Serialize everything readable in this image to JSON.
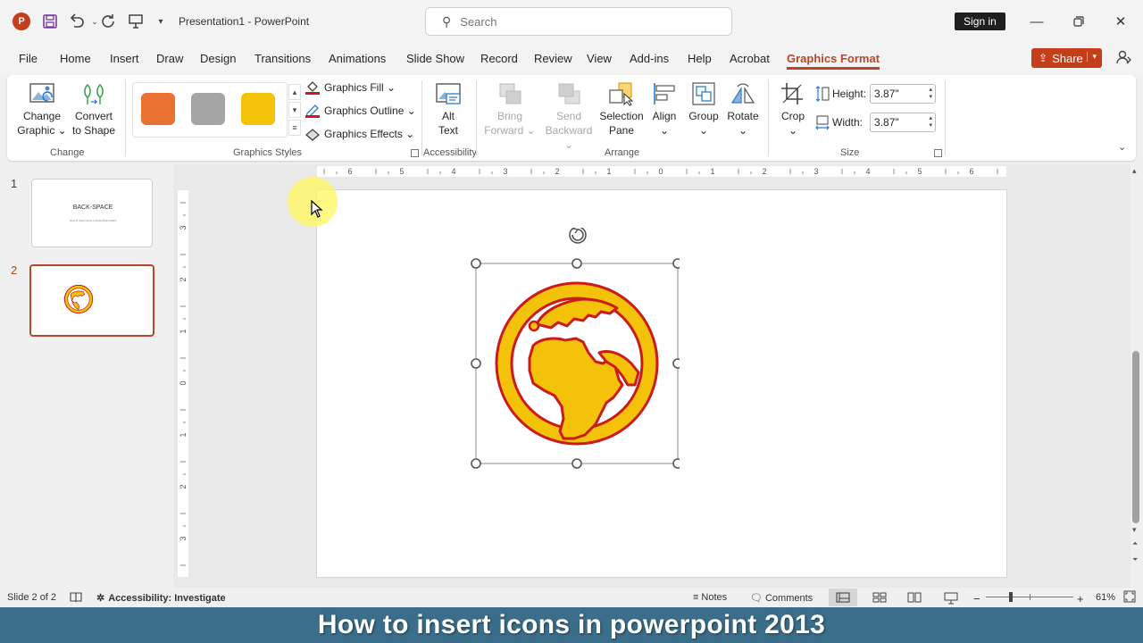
{
  "titlebar": {
    "app_logo": "P",
    "doc_title": "Presentation1  -  PowerPoint",
    "search_placeholder": "Search",
    "sign_in": "Sign in",
    "icons": [
      "save-icon",
      "undo-icon",
      "redo-icon",
      "present-icon",
      "customize-quick-access-icon",
      "minimize-icon",
      "restore-icon",
      "close-icon"
    ]
  },
  "menu": {
    "tabs": [
      "File",
      "Home",
      "Insert",
      "Draw",
      "Design",
      "Transitions",
      "Animations",
      "Slide Show",
      "Record",
      "Review",
      "View",
      "Add-ins",
      "Help",
      "Acrobat",
      "Graphics Format"
    ],
    "active": "Graphics Format",
    "share": "Share"
  },
  "ribbon": {
    "change": {
      "label": "Change",
      "change_graphic": [
        "Change",
        "Graphic ⌄"
      ],
      "convert": [
        "Convert",
        "to Shape"
      ]
    },
    "styles": {
      "label": "Graphics Styles",
      "swatches": [
        "#e97132",
        "#a5a5a5",
        "#f5c20a"
      ],
      "fill": "Graphics Fill ⌄",
      "outline": "Graphics Outline ⌄",
      "effects": "Graphics Effects ⌄"
    },
    "accessibility": {
      "label": "Accessibility",
      "alt_text": [
        "Alt",
        "Text"
      ]
    },
    "arrange": {
      "label": "Arrange",
      "bring_forward": [
        "Bring",
        "Forward ⌄"
      ],
      "send_backward": [
        "Send",
        "Backward ⌄"
      ],
      "selection_pane": [
        "Selection",
        "Pane"
      ],
      "align": [
        "Align",
        "⌄"
      ],
      "group": [
        "Group",
        "⌄"
      ],
      "rotate": [
        "Rotate",
        "⌄"
      ]
    },
    "size": {
      "label": "Size",
      "crop": [
        "Crop",
        "⌄"
      ],
      "height_label": "Height:",
      "height_value": "3.87\"",
      "width_label": "Width:",
      "width_value": "3.87\""
    }
  },
  "slides": [
    {
      "number": "1",
      "title": "BACK-SPACE",
      "subtitle": "How to insert icons in PowerPoint 2013"
    },
    {
      "number": "2",
      "active": true
    }
  ],
  "icon_colors": {
    "fill": "#f5c20a",
    "outline": "#cc1a1a"
  },
  "statusbar": {
    "slide_of": "Slide 2 of 2",
    "accessibility": "Accessibility: Investigate",
    "notes": "Notes",
    "comments": "Comments",
    "zoom_minus": "−",
    "zoom_plus": "+",
    "zoom": "61%"
  },
  "caption": "How to insert icons in powerpoint 2013"
}
